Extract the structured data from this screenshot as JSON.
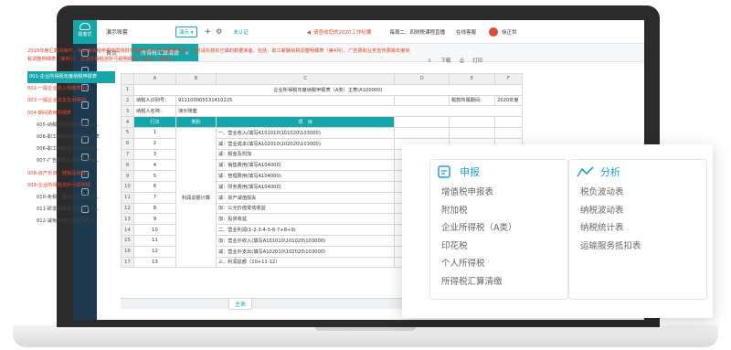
{
  "topbar": {
    "company": "演示账套",
    "select": "演示",
    "auth": "未认证",
    "notice": "请查收您的2020工作纪要",
    "live": "每周二、四财税课程直播",
    "service": "在线客服",
    "user": "徐正世",
    "logo": "极客优"
  },
  "tabs": [
    "首页",
    "所得税汇算清缴"
  ],
  "info": "2019年度汇算清缴时，在年度纳税申报前需将财务数据与会计年度数据生成，之前请先核实已填的数据准备，包括：职工薪酬纳税调整明细表（第4列）、广告费和业务宣传费跨年度纳税调整明细表（第8行）、企业所得税弥补亏损明细表（第2列、第8列）",
  "actions": {
    "download": "下载",
    "print": "打印"
  },
  "tree": [
    {
      "t": "001-企业所得税年度纳税申报表",
      "s": "on"
    },
    {
      "t": "002-一般企业收入明细表(A1...",
      "s": "red"
    },
    {
      "t": "003-一般企业成本支出明细...",
      "s": "red"
    },
    {
      "t": "004-期间费用明细表",
      "s": "red"
    },
    {
      "t": "005-纳税调整项目明细表(A...",
      "s": "ind"
    },
    {
      "t": "006-职工薪酬纳税调整明细表",
      "s": "ind"
    },
    {
      "t": "006-职工薪酬支出及纳税调...",
      "s": "ind"
    },
    {
      "t": "007-广告费和业务宣传费跨...",
      "s": "ind"
    },
    {
      "t": "008-资产折旧、摊销及纳税...",
      "s": "red"
    },
    {
      "t": "009-企业所得税弥补亏损明细",
      "s": "red"
    },
    {
      "t": "010-免税、减计收入及加计...",
      "s": "ind"
    },
    {
      "t": "011-研发费用加计扣除优惠...",
      "s": "ind"
    },
    {
      "t": "012-减免所得税优惠明细表",
      "s": "ind"
    }
  ],
  "sheet": {
    "cols": [
      "A",
      "B",
      "C",
      "D",
      "E"
    ],
    "title": "企业所得税年度纳税申报表（A类）主表(A100000)",
    "taxid_label": "纳税人识别号：",
    "taxid": "911100005531410225",
    "period_label": "税款所属期间：",
    "period": "2020年度",
    "name_label": "纳税人名称：",
    "name": "演示账套",
    "head": [
      "行次",
      "类别",
      "项　目"
    ],
    "category": "利润总额计算",
    "rows": [
      [
        "1",
        "一、营业收入(填写A101010\\101020\\103000)"
      ],
      [
        "2",
        "减：营业成本(填写A102010\\102020\\103000)"
      ],
      [
        "3",
        "减：税金及附加"
      ],
      [
        "4",
        "减：销售费用(填写A104000)"
      ],
      [
        "5",
        "减：管理费用(填写A104000)"
      ],
      [
        "6",
        "减：财务费用(填写A104000)"
      ],
      [
        "7",
        "减：资产减值损失"
      ],
      [
        "8",
        "加：公允价值变动收益"
      ],
      [
        "9",
        "加：投资收益"
      ],
      [
        "10",
        "二、营业利润(1-2-3-4-5-6-7+8+9)"
      ],
      [
        "11",
        "加：营业外收入(填写A101010\\101020\\103000)"
      ],
      [
        "12",
        "减：营业外支出(填写A102010\\102020\\103000)"
      ],
      [
        "13",
        "三、利润总额（10+11-12）"
      ]
    ],
    "sheet_tab": "主表"
  },
  "card": {
    "left": {
      "title": "申报",
      "items": [
        "增值税申报表",
        "附加税",
        "企业所得税（A类）",
        "印花税",
        "个人所得税",
        "所得税汇算清缴"
      ]
    },
    "right": {
      "title": "分析",
      "items": [
        "税负波动表",
        "纳税波动表",
        "纳税统计表",
        "运输服务抵扣表"
      ]
    }
  }
}
